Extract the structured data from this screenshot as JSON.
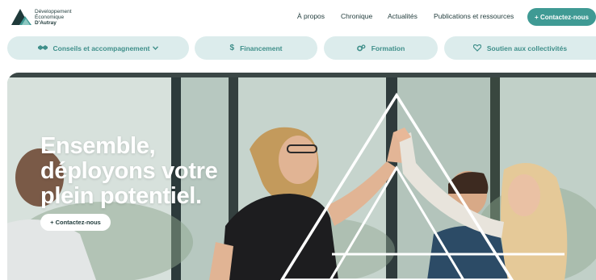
{
  "brand": {
    "line1": "Développement",
    "line2": "Économique",
    "line3": "D'Autray",
    "colors": {
      "accent": "#3f9a94",
      "dark": "#1f3a3a",
      "pill_bg": "#dcecec"
    }
  },
  "nav": {
    "items": [
      {
        "label": "À propos"
      },
      {
        "label": "Chronique"
      },
      {
        "label": "Actualités"
      },
      {
        "label": "Publications et ressources"
      }
    ],
    "cta_label": "+ Contactez-nous"
  },
  "categories": [
    {
      "label": "Conseils et accompagnement",
      "icon": "handshake-icon",
      "has_dropdown": true
    },
    {
      "label": "Financement",
      "icon": "dollar-icon",
      "has_dropdown": false
    },
    {
      "label": "Formation",
      "icon": "gears-icon",
      "has_dropdown": false
    },
    {
      "label": "Soutien aux collectivités",
      "icon": "heart-icon",
      "has_dropdown": false
    }
  ],
  "hero": {
    "headline_1": "Ensemble,",
    "headline_2": "déployons votre",
    "headline_3": "plein potentiel.",
    "cta_label": "+ Contactez-nous"
  }
}
